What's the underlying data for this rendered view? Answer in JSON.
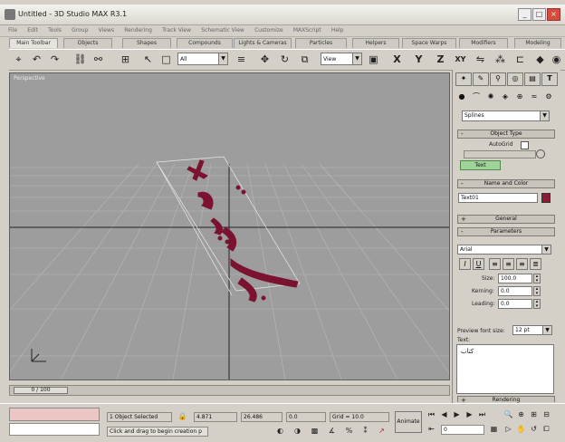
{
  "window": {
    "title": "Untitled - 3D Studio MAX R3.1"
  },
  "menu": [
    "File",
    "Edit",
    "Tools",
    "Group",
    "Views",
    "Rendering",
    "Track View",
    "Schematic View",
    "Customize",
    "MAXScript",
    "Help"
  ],
  "tabs": [
    "Main Toolbar",
    "Objects",
    "Shapes",
    "Compounds",
    "Lights & Cameras",
    "Particles",
    "Helpers",
    "Space Warps",
    "Modifiers",
    "Modeling"
  ],
  "toolbar": {
    "selection_filter": "All",
    "ref_coord": "View",
    "axes": [
      "X",
      "Y",
      "Z",
      "XY"
    ]
  },
  "viewport": {
    "label": "Perspective"
  },
  "panel": {
    "category_dropdown": "Splines",
    "object_type_header": "Object Type",
    "autogrid_label": "AutoGrid",
    "text_button": "Text",
    "name_color_header": "Name and Color",
    "object_name": "Text01",
    "object_color": "#8c1a36",
    "general_header": "General",
    "parameters_header": "Parameters",
    "font": "Arial",
    "size_label": "Size:",
    "size_value": "100.0",
    "kerning_label": "Kerning:",
    "kerning_value": "0.0",
    "leading_label": "Leading:",
    "leading_value": "0.0",
    "preview_label": "Preview font size:",
    "preview_value": "12 pt",
    "text_label": "Text:",
    "text_value": "كتاب",
    "rollout_sign": "+",
    "rollout_minus": "-",
    "rollout_footer": "Rendering"
  },
  "timeslider": {
    "label": "0 / 100"
  },
  "status": {
    "selected": "1 Object Selected",
    "prompt": "Click and drag to begin creation p",
    "x": "4.871",
    "y": "26.486",
    "z": "0.0",
    "grid": "Grid = 10.0",
    "animate_label": "Animate",
    "frame_value": "0"
  }
}
